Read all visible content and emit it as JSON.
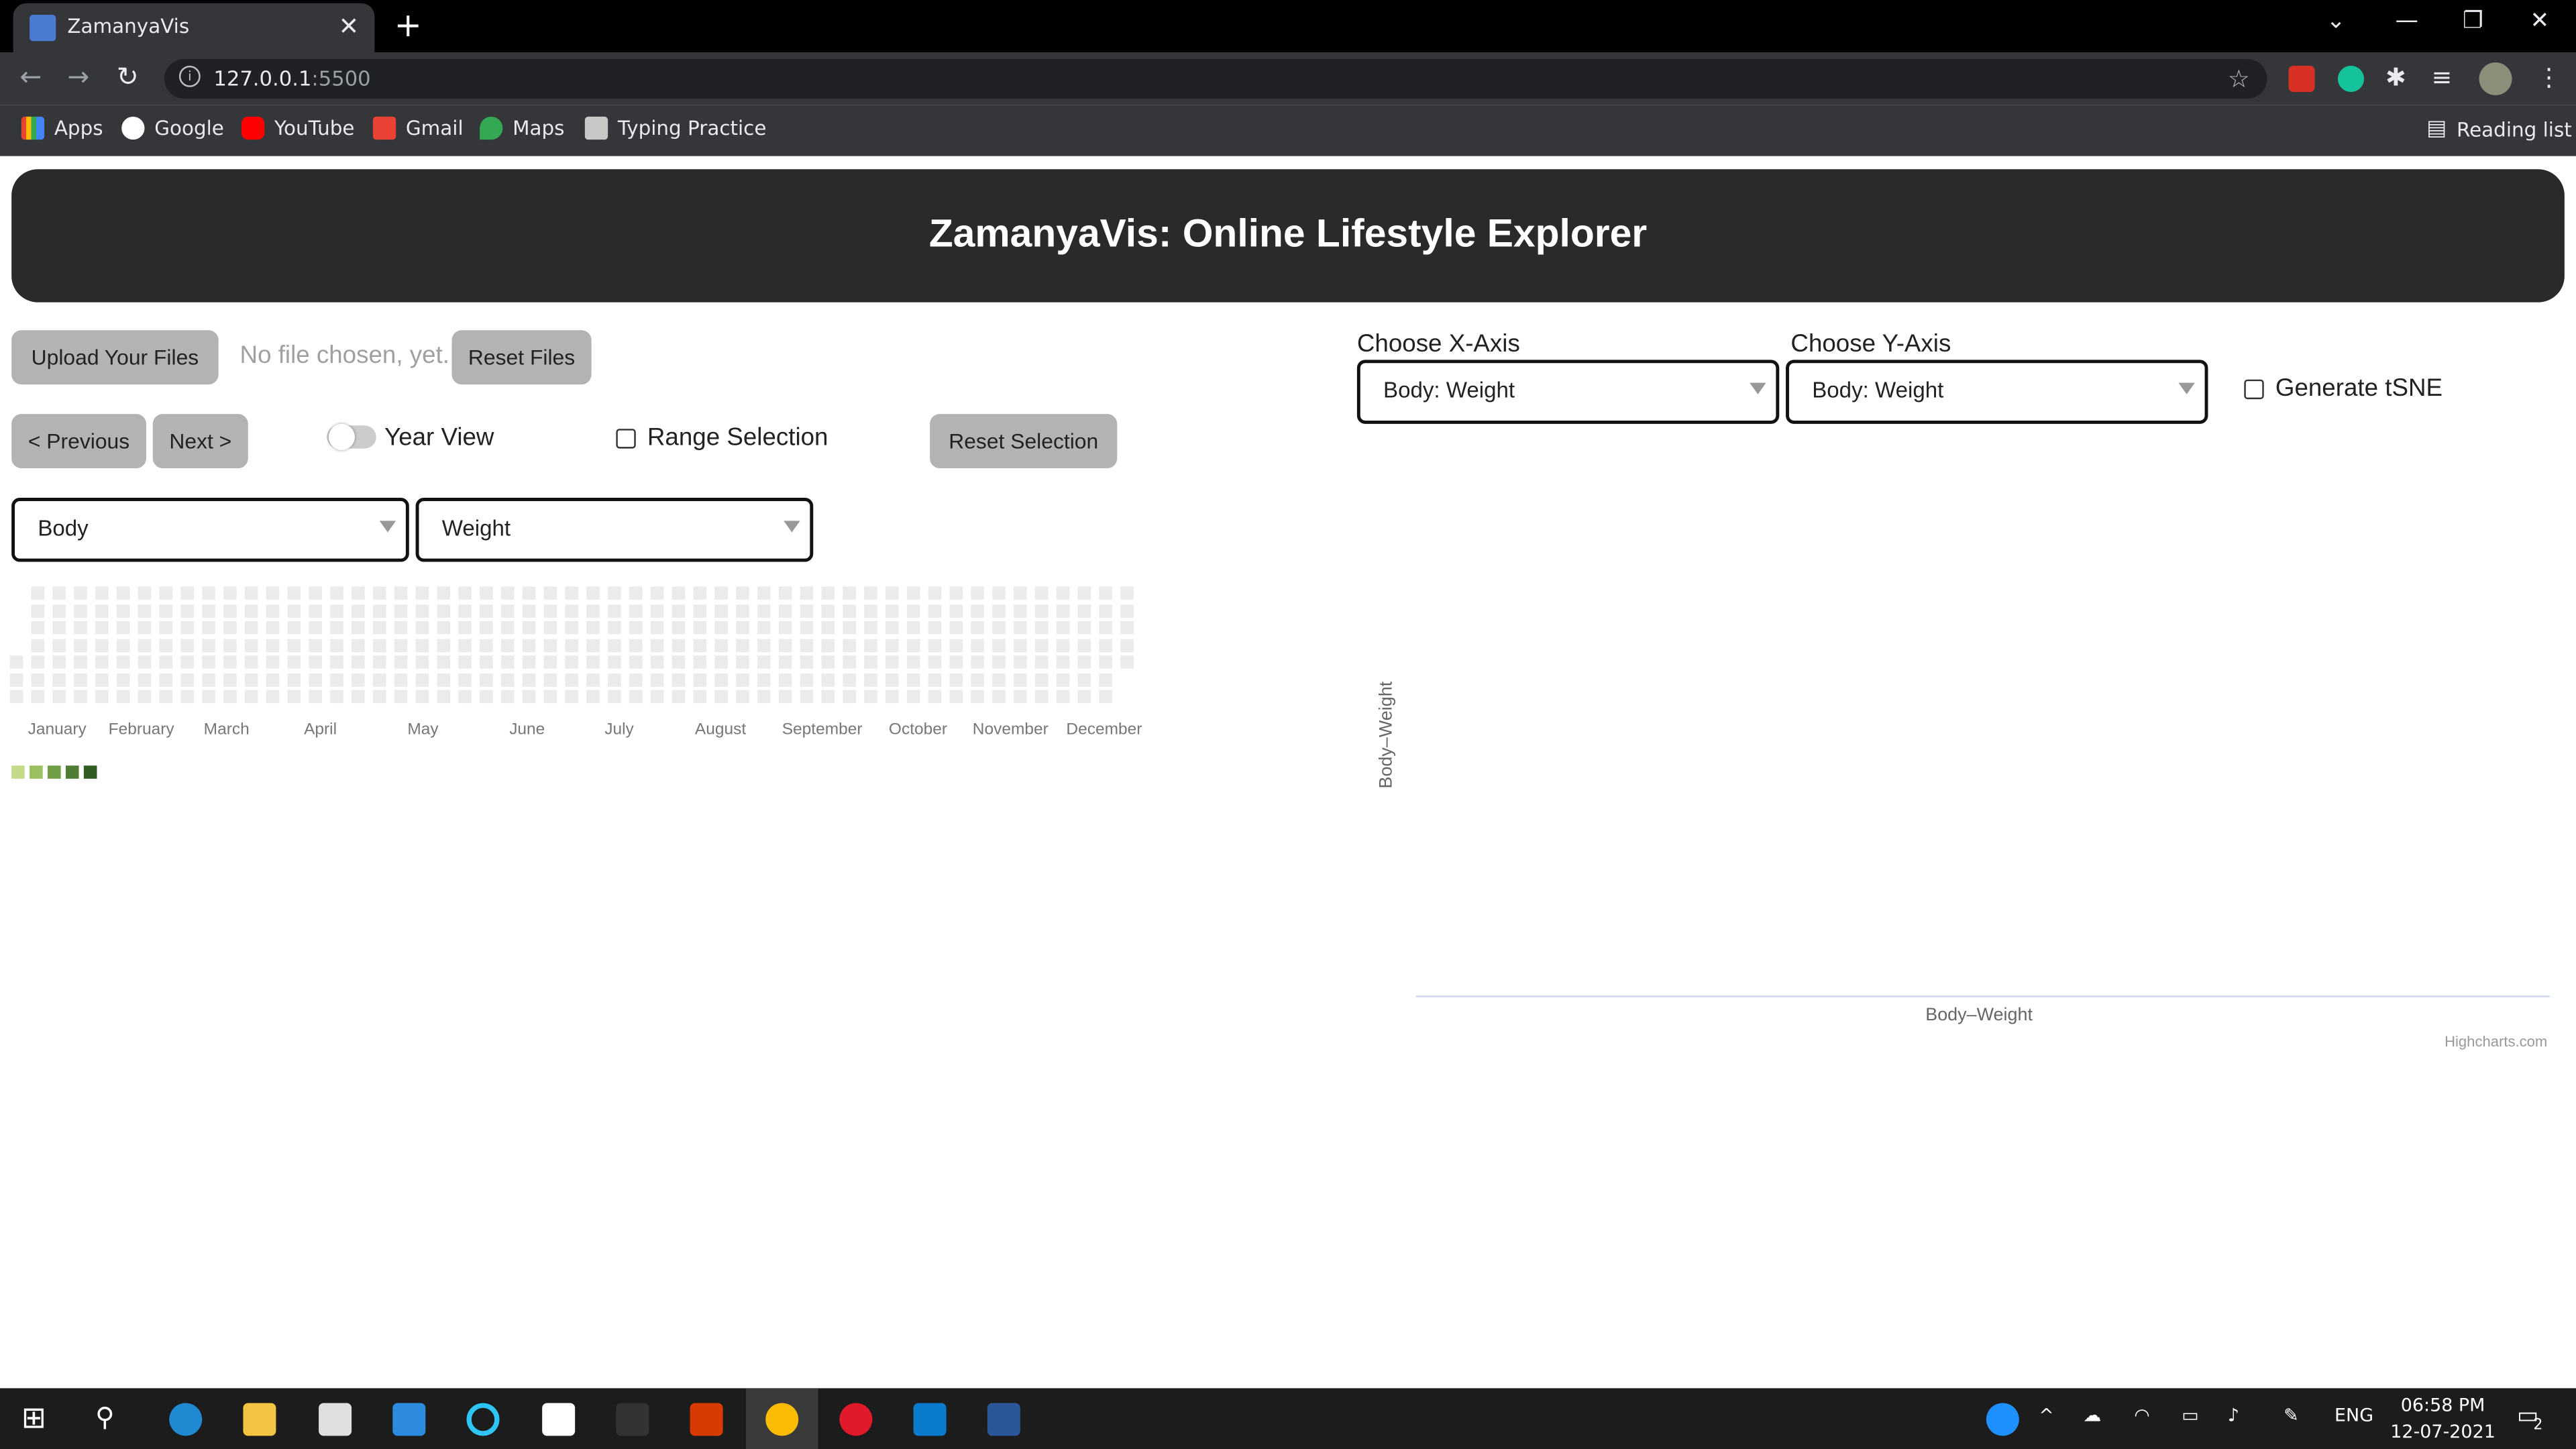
{
  "browser": {
    "tab_title": "ZamanyaVis",
    "tab_close": "✕",
    "new_tab": "+",
    "url_host": "127.0.0.1",
    "url_port": ":5500",
    "bookmarks": [
      "Apps",
      "Google",
      "YouTube",
      "Gmail",
      "Maps",
      "Typing Practice"
    ],
    "reading_list": "Reading list"
  },
  "page": {
    "title": "ZamanyaVis: Online Lifestyle Explorer",
    "upload_button": "Upload Your Files",
    "file_status": "No file chosen, yet.",
    "reset_files_button": "Reset Files",
    "prev_button": "< Previous",
    "next_button": "Next >",
    "year_view_label": "Year View",
    "range_selection_label": "Range Selection",
    "reset_selection_button": "Reset Selection",
    "category_select": "Body",
    "metric_select": "Weight",
    "months": [
      "January",
      "February",
      "March",
      "April",
      "May",
      "June",
      "July",
      "August",
      "September",
      "October",
      "November",
      "December"
    ],
    "legend_colors": [
      "#c5d98b",
      "#9bbf5e",
      "#6f9e45",
      "#4f7d34",
      "#2f5d22"
    ],
    "empty_cell_color": "#ebebeb"
  },
  "scatter": {
    "x_axis_label": "Choose X-Axis",
    "y_axis_label": "Choose Y-Axis",
    "x_select": "Body: Weight",
    "y_select": "Body: Weight",
    "tsne_label": "Generate tSNE",
    "chart_x_title": "Body–Weight",
    "chart_y_title": "Body–Weight",
    "credits": "Highcharts.com"
  },
  "taskbar": {
    "lang": "ENG",
    "time": "06:58 PM",
    "date": "12-07-2021",
    "notifications": "2"
  }
}
